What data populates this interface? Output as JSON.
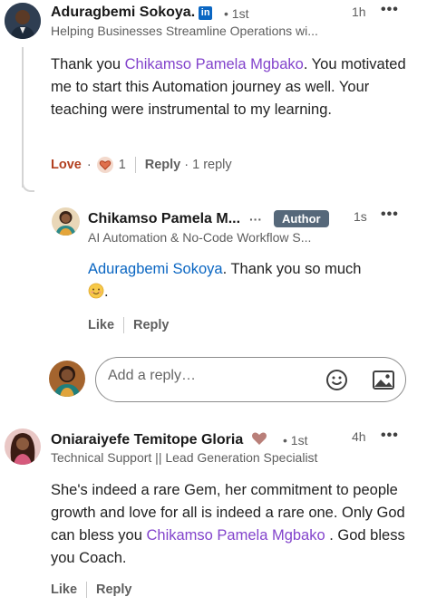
{
  "comments": [
    {
      "author": "Aduragbemi Sokoya.",
      "degree": "• 1st",
      "headline": "Helping Businesses Streamline Operations wi...",
      "time": "1h",
      "more": "•••",
      "body_part1": "Thank you ",
      "body_mention": "Chikamso Pamela Mgbako",
      "body_part2": ". You motivated me to start this Automation journey as well. Your teaching were instrumental to my learning.",
      "reaction_label": "Love",
      "reaction_dot": "·",
      "reaction_count": "1",
      "reply_label": "Reply",
      "reply_count": "· 1 reply"
    },
    {
      "author": "Oniaraiyefe Temitope Gloria",
      "degree": "• 1st",
      "headline": "Technical Support || Lead Generation Specialist",
      "time": "4h",
      "more": "•••",
      "body_part1": "She's indeed a rare Gem, her commitment to people growth and love for all is indeed a rare one. Only God can bless you ",
      "body_mention": "Chikamso Pamela Mgbako",
      "body_part2": " . God bless you Coach.",
      "like_label": "Like",
      "reply_label": "Reply"
    }
  ],
  "reply": {
    "author": "Chikamso Pamela M...",
    "ellipsis": "···",
    "badge": "Author",
    "headline": "AI Automation & No-Code Workflow S...",
    "time": "1s",
    "more": "•••",
    "mention": "Aduragbemi Sokoya",
    "body_part2": ". Thank you so much",
    "body_line2": ".",
    "like_label": "Like",
    "reply_label": "Reply"
  },
  "reply_input": {
    "placeholder": "Add a reply…"
  },
  "icons": {
    "linkedin": "in",
    "emoji": "emoji-icon",
    "image": "image-icon"
  },
  "colors": {
    "mention": "#8344cc",
    "link": "#0a66c2",
    "love": "#b24020",
    "author_badge": "#56687a"
  }
}
